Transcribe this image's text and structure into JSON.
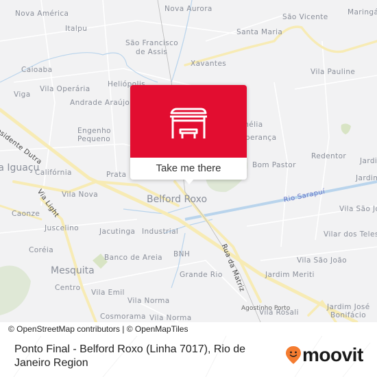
{
  "map": {
    "labels": [
      {
        "text": "Nova América",
        "cls": ""
      },
      {
        "text": "Italpu",
        "cls": ""
      },
      {
        "text": "Nova Aurora",
        "cls": ""
      },
      {
        "text": "São Vicente",
        "cls": ""
      },
      {
        "text": "Maringá",
        "cls": ""
      },
      {
        "text": "Santa Maria",
        "cls": ""
      },
      {
        "text": "São Francisco",
        "cls": ""
      },
      {
        "text": "de Assis",
        "cls": ""
      },
      {
        "text": "Xavantes",
        "cls": ""
      },
      {
        "text": "Vila Pauline",
        "cls": ""
      },
      {
        "text": "Caioaba",
        "cls": ""
      },
      {
        "text": "Heliópolis",
        "cls": ""
      },
      {
        "text": "Viga",
        "cls": ""
      },
      {
        "text": "Vila Operária",
        "cls": ""
      },
      {
        "text": "Andrade Araújo",
        "cls": ""
      },
      {
        "text": "Engenho",
        "cls": ""
      },
      {
        "text": "Pequeno",
        "cls": ""
      },
      {
        "text": "Amélia",
        "cls": ""
      },
      {
        "text": "Esperança",
        "cls": ""
      },
      {
        "text": "Redentor",
        "cls": ""
      },
      {
        "text": "Jardim",
        "cls": ""
      },
      {
        "text": "Bom Pastor",
        "cls": ""
      },
      {
        "text": "Califórnia",
        "cls": ""
      },
      {
        "text": "Prata",
        "cls": ""
      },
      {
        "text": "Nova Iguaçu",
        "cls": "big"
      },
      {
        "text": "Vila Nova",
        "cls": ""
      },
      {
        "text": "Belford Roxo",
        "cls": "big"
      },
      {
        "text": "Jardim",
        "cls": ""
      },
      {
        "text": "Vila São João",
        "cls": ""
      },
      {
        "text": "Caonze",
        "cls": ""
      },
      {
        "text": "Juscelino",
        "cls": ""
      },
      {
        "text": "Jacutinga",
        "cls": ""
      },
      {
        "text": "Industrial",
        "cls": ""
      },
      {
        "text": "Vilar dos Teles",
        "cls": ""
      },
      {
        "text": "Coréia",
        "cls": ""
      },
      {
        "text": "Banco de Areia",
        "cls": ""
      },
      {
        "text": "BNH",
        "cls": ""
      },
      {
        "text": "Vila São João",
        "cls": ""
      },
      {
        "text": "Mesquita",
        "cls": "big"
      },
      {
        "text": "Grande Rio",
        "cls": ""
      },
      {
        "text": "Jardim Meriti",
        "cls": ""
      },
      {
        "text": "Centro",
        "cls": ""
      },
      {
        "text": "Vila Emil",
        "cls": ""
      },
      {
        "text": "Vila Norma",
        "cls": ""
      },
      {
        "text": "Agostinho Porto",
        "cls": "small"
      },
      {
        "text": "Jardim José",
        "cls": ""
      },
      {
        "text": "Bonifácio",
        "cls": ""
      },
      {
        "text": "Cosmorama",
        "cls": ""
      },
      {
        "text": "Vila Norma",
        "cls": ""
      },
      {
        "text": "Vila Rosali",
        "cls": ""
      },
      {
        "text": "Presidente Dutra",
        "cls": "road"
      },
      {
        "text": "Via Light",
        "cls": "road"
      },
      {
        "text": "Rua da Matriz",
        "cls": "road"
      },
      {
        "text": "Rio Sarapuí",
        "cls": "river"
      }
    ]
  },
  "popup": {
    "icon": "bus-stop-icon",
    "cta_label": "Take me there",
    "color": "#e20d30"
  },
  "attribution": "© OpenStreetMap contributors | © OpenMapTiles",
  "footer": {
    "title": "Ponto Final - Belford Roxo (Linha 7017), Rio de Janeiro Region",
    "logo_text": "moovit",
    "logo_color": "#f47c30"
  }
}
